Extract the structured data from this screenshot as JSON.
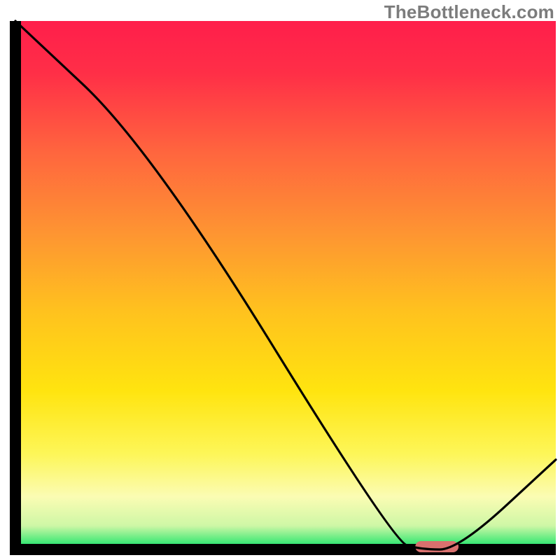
{
  "watermark": "TheBottleneck.com",
  "chart_data": {
    "type": "line",
    "title": "",
    "xlabel": "",
    "ylabel": "",
    "xlim": [
      0,
      100
    ],
    "ylim": [
      0,
      100
    ],
    "x": [
      0,
      25,
      70,
      75,
      82,
      100
    ],
    "values": [
      100,
      76,
      1.5,
      0,
      0,
      17
    ],
    "marker": {
      "x_start": 74,
      "x_end": 82,
      "y": 0
    },
    "gradient_stops": [
      {
        "offset": 0.0,
        "color": "#ff1e4b"
      },
      {
        "offset": 0.1,
        "color": "#ff2f47"
      },
      {
        "offset": 0.25,
        "color": "#ff663e"
      },
      {
        "offset": 0.4,
        "color": "#fe9432"
      },
      {
        "offset": 0.55,
        "color": "#ffc21e"
      },
      {
        "offset": 0.7,
        "color": "#ffe40f"
      },
      {
        "offset": 0.82,
        "color": "#fdf659"
      },
      {
        "offset": 0.9,
        "color": "#fbfcb3"
      },
      {
        "offset": 0.955,
        "color": "#cef7a6"
      },
      {
        "offset": 0.985,
        "color": "#4be97a"
      },
      {
        "offset": 1.0,
        "color": "#08dd6a"
      }
    ],
    "marker_color": "#d9706e",
    "curve_color": "#000000",
    "axis_color": "#000000"
  }
}
